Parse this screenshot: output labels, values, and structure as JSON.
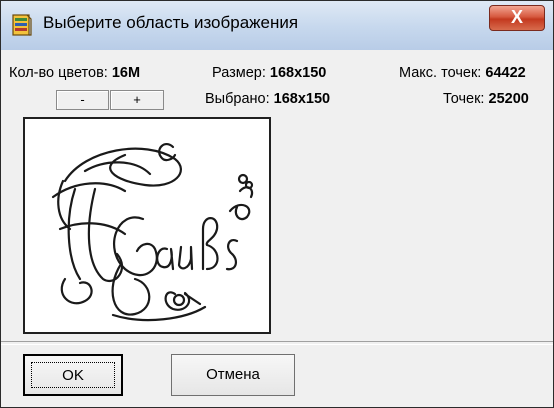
{
  "window": {
    "title": "Выберите область изображения",
    "close_label": "X"
  },
  "info": {
    "colors_label": "Кол-во цветов:",
    "colors_value": "16M",
    "size_label": "Размер:",
    "size_value": "168x150",
    "max_points_label": "Макс. точек:",
    "max_points_value": "64422",
    "selected_label": "Выбрано:",
    "selected_value": "168x150",
    "points_label": "Точек:",
    "points_value": "25200",
    "minus_label": "-",
    "plus_label": "+"
  },
  "buttons": {
    "ok": "OK",
    "cancel": "Отмена"
  },
  "preview": {
    "content": "handwritten monogram sketch with the word 'Gaußs'",
    "ink_color": "#1a1a1a"
  },
  "colors": {
    "close_button": "#c9452b",
    "titlebar": "#c8d9ee",
    "dialog_bg": "#f0f0f0"
  }
}
